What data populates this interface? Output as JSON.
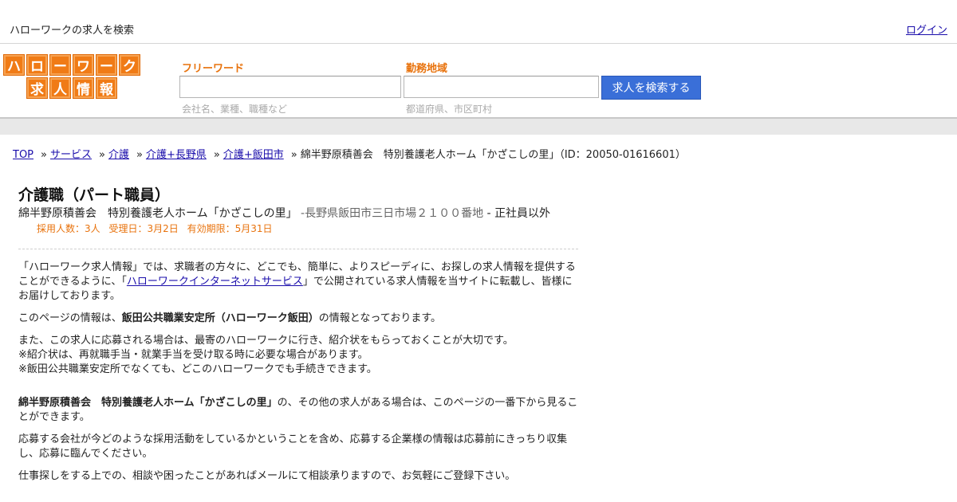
{
  "topbar": {
    "site_title": "ハローワークの求人を検索",
    "login_label": "ログイン"
  },
  "logo": {
    "row1": [
      "ハ",
      "ロ",
      "ー",
      "ワ",
      "ー",
      "ク"
    ],
    "row2": [
      "求",
      "人",
      "情",
      "報"
    ]
  },
  "search": {
    "freeword_label": "フリーワード",
    "freeword_hint": "会社名、業種、職種など",
    "area_label": "勤務地域",
    "area_hint": "都道府県、市区町村",
    "button_label": "求人を検索する"
  },
  "breadcrumb": {
    "items": [
      "TOP",
      "サービス",
      "介護",
      "介護+長野県",
      "介護+飯田市"
    ],
    "current": "綿半野原積善会　特別養護老人ホーム「かざこしの里」（ID：20050-01616601）"
  },
  "job": {
    "title": "介護職（パート職員）",
    "company": "綿半野原積善会　特別養護老人ホーム「かざこしの里」",
    "address": "長野県飯田市三日市場２１００番地",
    "employment": "正社員以外",
    "hires": "採用人数：3人",
    "received": "受理日：3月2日",
    "expiry": "有効期限：5月31日"
  },
  "body": {
    "p1_a": "「ハローワーク求人情報」では、求職者の方々に、どこでも、簡単に、よりスピーディに、お探しの求人情報を提供することができるように、「",
    "p1_link": "ハローワークインターネットサービス",
    "p1_b": "」で公開されている求人情報を当サイトに転載し、皆様にお届けしております。",
    "p2_a": "このページの情報は、",
    "p2_bold": "飯田公共職業安定所（ハローワーク飯田）",
    "p2_b": "の情報となっております。",
    "p3_l1": "また、この求人に応募される場合は、最寄のハローワークに行き、紹介状をもらっておくことが大切です。",
    "p3_l2": "※紹介状は、再就職手当・就業手当を受け取る時に必要な場合があります。",
    "p3_l3": "※飯田公共職業安定所でなくても、どこのハローワークでも手続きできます。",
    "p4_bold": "綿半野原積善会　特別養護老人ホーム「かざこしの里」",
    "p4_b": "の、その他の求人がある場合は、このページの一番下から見ることができます。",
    "p5": "応募する会社が今どのような採用活動をしているかということを含め、応募する企業様の情報は応募前にきっちり収集し、応募に臨んでください。",
    "p6": "仕事探しをする上での、相談や困ったことがあればメールにて相談承りますので、お気軽にご登録下さい。"
  }
}
